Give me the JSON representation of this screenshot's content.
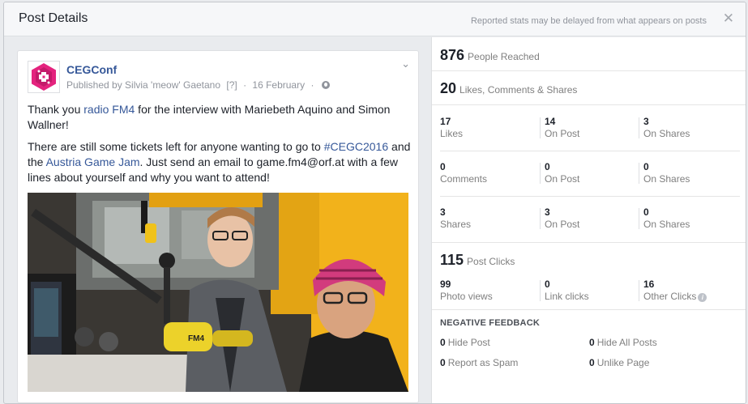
{
  "header": {
    "title": "Post Details",
    "note": "Reported stats may be delayed from what appears on posts",
    "close_glyph": "✕"
  },
  "post": {
    "page_name": "CEGConf",
    "published_by": "Published by Silvia 'meow' Gaetano",
    "help_marker": "[?]",
    "date": "16 February",
    "chevron": "⌄",
    "p1_a": "Thank you ",
    "p1_link": "radio FM4",
    "p1_b": " for the interview with Mariebeth Aquino and Simon Wallner!",
    "p2_a": "There are still some tickets left for anyone wanting to go to ",
    "p2_link1": "#CEGC2016",
    "p2_b": " and the ",
    "p2_link2": "Austria Game Jam",
    "p2_c": ". Just send an email to game.fm4@orf.at with a few lines about yourself and why you want to attend!",
    "mic_text": "FM4"
  },
  "stats": {
    "reached": {
      "value": "876",
      "label": "People Reached"
    },
    "engagement": {
      "value": "20",
      "label": "Likes, Comments & Shares"
    },
    "likes": [
      {
        "value": "17",
        "label": "Likes"
      },
      {
        "value": "14",
        "label": "On Post"
      },
      {
        "value": "3",
        "label": "On Shares"
      }
    ],
    "comments": [
      {
        "value": "0",
        "label": "Comments"
      },
      {
        "value": "0",
        "label": "On Post"
      },
      {
        "value": "0",
        "label": "On Shares"
      }
    ],
    "shares": [
      {
        "value": "3",
        "label": "Shares"
      },
      {
        "value": "3",
        "label": "On Post"
      },
      {
        "value": "0",
        "label": "On Shares"
      }
    ],
    "clicks": {
      "value": "115",
      "label": "Post Clicks"
    },
    "click_breakdown": [
      {
        "value": "99",
        "label": "Photo views"
      },
      {
        "value": "0",
        "label": "Link clicks"
      },
      {
        "value": "16",
        "label": "Other Clicks"
      }
    ],
    "info_glyph": "i",
    "negative": {
      "title": "NEGATIVE FEEDBACK",
      "items": [
        {
          "value": "0",
          "label": "Hide Post"
        },
        {
          "value": "0",
          "label": "Hide All Posts"
        },
        {
          "value": "0",
          "label": "Report as Spam"
        },
        {
          "value": "0",
          "label": "Unlike Page"
        }
      ]
    }
  }
}
